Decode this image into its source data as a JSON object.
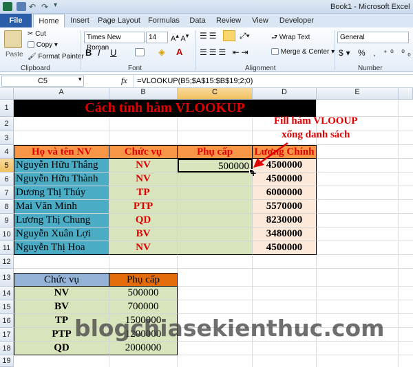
{
  "window": {
    "title": "Book1 - Microsoft Excel"
  },
  "tabs": [
    "File",
    "Home",
    "Insert",
    "Page Layout",
    "Formulas",
    "Data",
    "Review",
    "View",
    "Developer"
  ],
  "ribbon": {
    "clipboard": {
      "paste": "Paste",
      "cut": "Cut",
      "copy": "Copy",
      "format_painter": "Format Painter",
      "group": "Clipboard"
    },
    "font": {
      "name": "Times New Roman",
      "size": "14",
      "group": "Font"
    },
    "alignment": {
      "wrap": "Wrap Text",
      "merge": "Merge & Center",
      "group": "Alignment"
    },
    "number": {
      "format": "General",
      "group": "Number"
    }
  },
  "formula_bar": {
    "name_box": "C5",
    "fx": "fx",
    "formula": "=VLOOKUP(B5;$A$15:$B$19;2;0)"
  },
  "columns": [
    "A",
    "B",
    "C",
    "D",
    "E"
  ],
  "rows": [
    "1",
    "2",
    "3",
    "4",
    "5",
    "6",
    "7",
    "8",
    "9",
    "10",
    "11",
    "12",
    "13",
    "14",
    "15",
    "16",
    "17",
    "18",
    "19"
  ],
  "sheet": {
    "title": "Cách tính hàm VLOOKUP",
    "headers": [
      "Họ và tên NV",
      "Chức vụ",
      "Phụ cấp",
      "Lương Chính"
    ],
    "employees": [
      {
        "name": "Nguyễn Hữu Thắng",
        "role": "NV",
        "allowance": "500000",
        "salary": "4500000"
      },
      {
        "name": "Nguyễn Hữu Thành",
        "role": "NV",
        "allowance": "",
        "salary": "4500000"
      },
      {
        "name": "Dương Thị Thúy",
        "role": "TP",
        "allowance": "",
        "salary": "6000000"
      },
      {
        "name": "Mai Văn Minh",
        "role": "PTP",
        "allowance": "",
        "salary": "5570000"
      },
      {
        "name": "Lương Thị Chung",
        "role": "QD",
        "allowance": "",
        "salary": "8230000"
      },
      {
        "name": "Nguyễn Xuân Lợi",
        "role": "BV",
        "allowance": "",
        "salary": "3480000"
      },
      {
        "name": "Nguyễn Thị Hoa",
        "role": "NV",
        "allowance": "",
        "salary": "4500000"
      }
    ],
    "lookup_headers": [
      "Chức vụ",
      "Phụ cấp"
    ],
    "lookup": [
      {
        "role": "NV",
        "allowance": "500000"
      },
      {
        "role": "BV",
        "allowance": "700000"
      },
      {
        "role": "TP",
        "allowance": "1500000"
      },
      {
        "role": "PTP",
        "allowance": "1200000"
      },
      {
        "role": "QD",
        "allowance": "2000000"
      }
    ]
  },
  "annotation": {
    "line1": "Fill hàm VLOOUP",
    "line2": "xống danh sách"
  },
  "watermark": "blogchiasekienthuc.com",
  "colors": {
    "header_orange": "#f79646",
    "name_blue": "#4bacc6",
    "green": "#d8e4bc",
    "peach": "#fde9d9",
    "title_black": "#000000",
    "red": "#e00000",
    "lookup_blue": "#95b3d7",
    "lookup_orange": "#e46c0a"
  }
}
